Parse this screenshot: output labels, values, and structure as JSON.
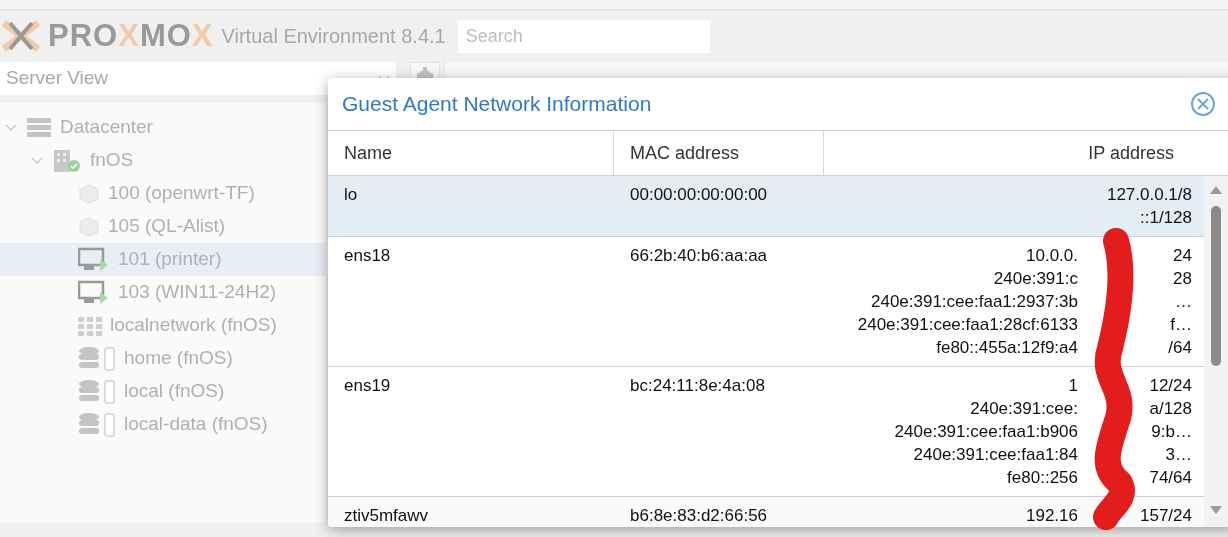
{
  "header": {
    "logo": [
      "PRO",
      "X",
      "MO",
      "X"
    ],
    "product": "Virtual Environment 8.4.1",
    "search": {
      "placeholder": "Search"
    }
  },
  "sidebar": {
    "view": "Server View",
    "tree": [
      {
        "label": "Datacenter",
        "kind": "datacenter",
        "expanded": true,
        "selected": false,
        "children": [
          {
            "label": "fnOS",
            "kind": "node",
            "expanded": true,
            "selected": false,
            "online": true,
            "children": [
              {
                "label": "100 (openwrt-TF)",
                "kind": "container",
                "selected": false
              },
              {
                "label": "105 (QL-Alist)",
                "kind": "container",
                "selected": false
              },
              {
                "label": "101 (printer)",
                "kind": "vm",
                "selected": true,
                "running": true
              },
              {
                "label": "103 (WIN11-24H2)",
                "kind": "vm",
                "selected": false,
                "running": true
              },
              {
                "label": "localnetwork (fnOS)",
                "kind": "sdn",
                "selected": false
              },
              {
                "label": "home (fnOS)",
                "kind": "storage",
                "selected": false
              },
              {
                "label": "local (fnOS)",
                "kind": "storage",
                "selected": false
              },
              {
                "label": "local-data (fnOS)",
                "kind": "storage",
                "selected": false
              }
            ]
          }
        ]
      }
    ]
  },
  "dialog": {
    "title": "Guest Agent Network Information",
    "columns": [
      "Name",
      "MAC address",
      "IP address"
    ],
    "rows": [
      {
        "name": "lo",
        "mac": "00:00:00:00:00:00",
        "selected": true,
        "ips": [
          [
            "127.0.0.1/8"
          ],
          [
            "::1/128"
          ]
        ]
      },
      {
        "name": "ens18",
        "mac": "66:2b:40:b6:aa:aa",
        "selected": false,
        "ips": [
          [
            "10.0.0.",
            "24"
          ],
          [
            "240e:391:c",
            "28"
          ],
          [
            "240e:391:cee:faa1:2937:3b",
            "…"
          ],
          [
            "240e:391:cee:faa1:28cf:6133",
            "f…"
          ],
          [
            "fe80::455a:12f9:a4",
            "/64"
          ]
        ]
      },
      {
        "name": "ens19",
        "mac": "bc:24:11:8e:4a:08",
        "selected": false,
        "ips": [
          [
            "1",
            "12/24"
          ],
          [
            "240e:391:cee:",
            "a/128"
          ],
          [
            "240e:391:cee:faa1:b906",
            "9:b…"
          ],
          [
            "240e:391:cee:faa1:84",
            "3…"
          ],
          [
            "fe80::256",
            "74/64"
          ]
        ]
      },
      {
        "name": "ztiv5mfawv",
        "mac": "b6:8e:83:d2:66:56",
        "selected": false,
        "ips": [
          [
            "192.16",
            "157/24"
          ]
        ]
      }
    ]
  }
}
